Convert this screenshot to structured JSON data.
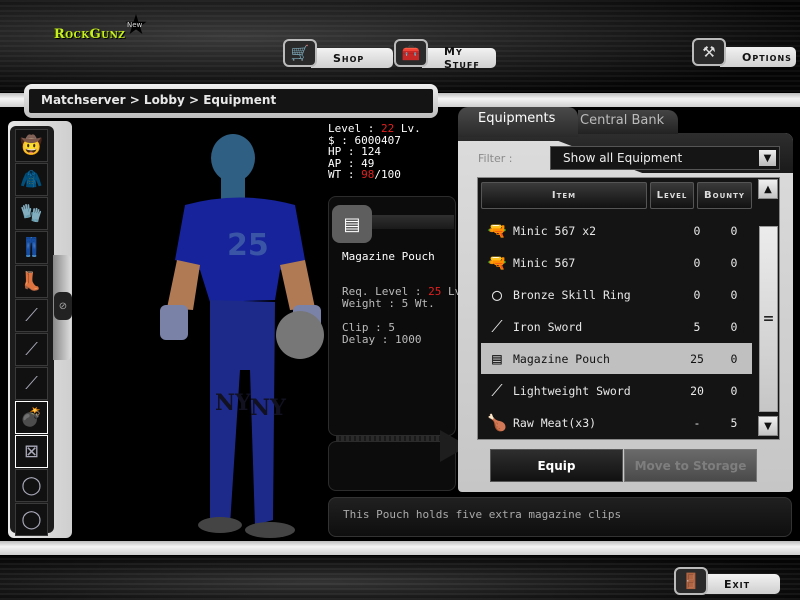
{
  "logo": {
    "text": "RockGunz",
    "badge": "New"
  },
  "nav": {
    "shop": {
      "label": "Shop",
      "icon": "shopping-cart"
    },
    "my_stuff": {
      "label": "My Stuff",
      "icon": "toolbox"
    },
    "options": {
      "label": "Options",
      "icon": "wrench-hammer"
    },
    "exit": {
      "label": "Exit",
      "icon": "door-exit"
    }
  },
  "breadcrumb": "Matchserver > Lobby > Equipment",
  "slots": [
    {
      "item": "hat",
      "glyph": "🤠"
    },
    {
      "item": "jacket",
      "glyph": "🧥"
    },
    {
      "item": "gloves",
      "glyph": "🧤"
    },
    {
      "item": "pants",
      "glyph": "👖"
    },
    {
      "item": "boots",
      "glyph": "👢"
    },
    {
      "item": "sword",
      "glyph": "⟋"
    },
    {
      "item": "rifle",
      "glyph": "⟋"
    },
    {
      "item": "rifle",
      "glyph": "⟋"
    },
    {
      "item": "grenade",
      "glyph": "💣"
    },
    {
      "item": "empty",
      "glyph": "⊠"
    },
    {
      "item": "ring",
      "glyph": "◯"
    },
    {
      "item": "ring",
      "glyph": "◯"
    }
  ],
  "stats": {
    "level_label": "Level : ",
    "level": "22",
    "level_unit": " Lv.",
    "money": "$ : 6000407",
    "hp": "HP : 124",
    "ap": "AP : 49",
    "wt_label": "WT : ",
    "wt": "98",
    "wt_max": "/100"
  },
  "item_info": {
    "name": "Magazine Pouch",
    "req_label": "Req. Level : ",
    "req_level": "25",
    "req_unit": " Lv.",
    "weight": "Weight : 5 Wt.",
    "clip": "Clip : 5",
    "delay": "Delay : 1000"
  },
  "description": "This Pouch holds five extra magazine clips",
  "tabs": {
    "active": "Equipments",
    "inactive": "Central Bank"
  },
  "filter": {
    "label": "Filter :",
    "value": "Show all Equipment"
  },
  "table": {
    "headers": {
      "item": "Item",
      "level": "Level",
      "bounty": "Bounty"
    },
    "rows": [
      {
        "icon": "🔫",
        "name": "Minic 567 x2",
        "level": "0",
        "bounty": "0"
      },
      {
        "icon": "🔫",
        "name": "Minic 567",
        "level": "0",
        "bounty": "0"
      },
      {
        "icon": "◯",
        "name": "Bronze Skill Ring",
        "level": "0",
        "bounty": "0"
      },
      {
        "icon": "⟋",
        "name": "Iron Sword",
        "level": "5",
        "bounty": "0"
      },
      {
        "icon": "▤",
        "name": "Magazine Pouch",
        "level": "25",
        "bounty": "0",
        "selected": true
      },
      {
        "icon": "⟋",
        "name": "Lightweight Sword",
        "level": "20",
        "bounty": "0"
      },
      {
        "icon": "🍗",
        "name": "Raw Meat(x3)",
        "level": "-",
        "bounty": "5"
      }
    ]
  },
  "buttons": {
    "equip": "Equip",
    "move": "Move to Storage"
  },
  "colors": {
    "accent_red": "#e02020",
    "logo_green": "#c8f020"
  }
}
